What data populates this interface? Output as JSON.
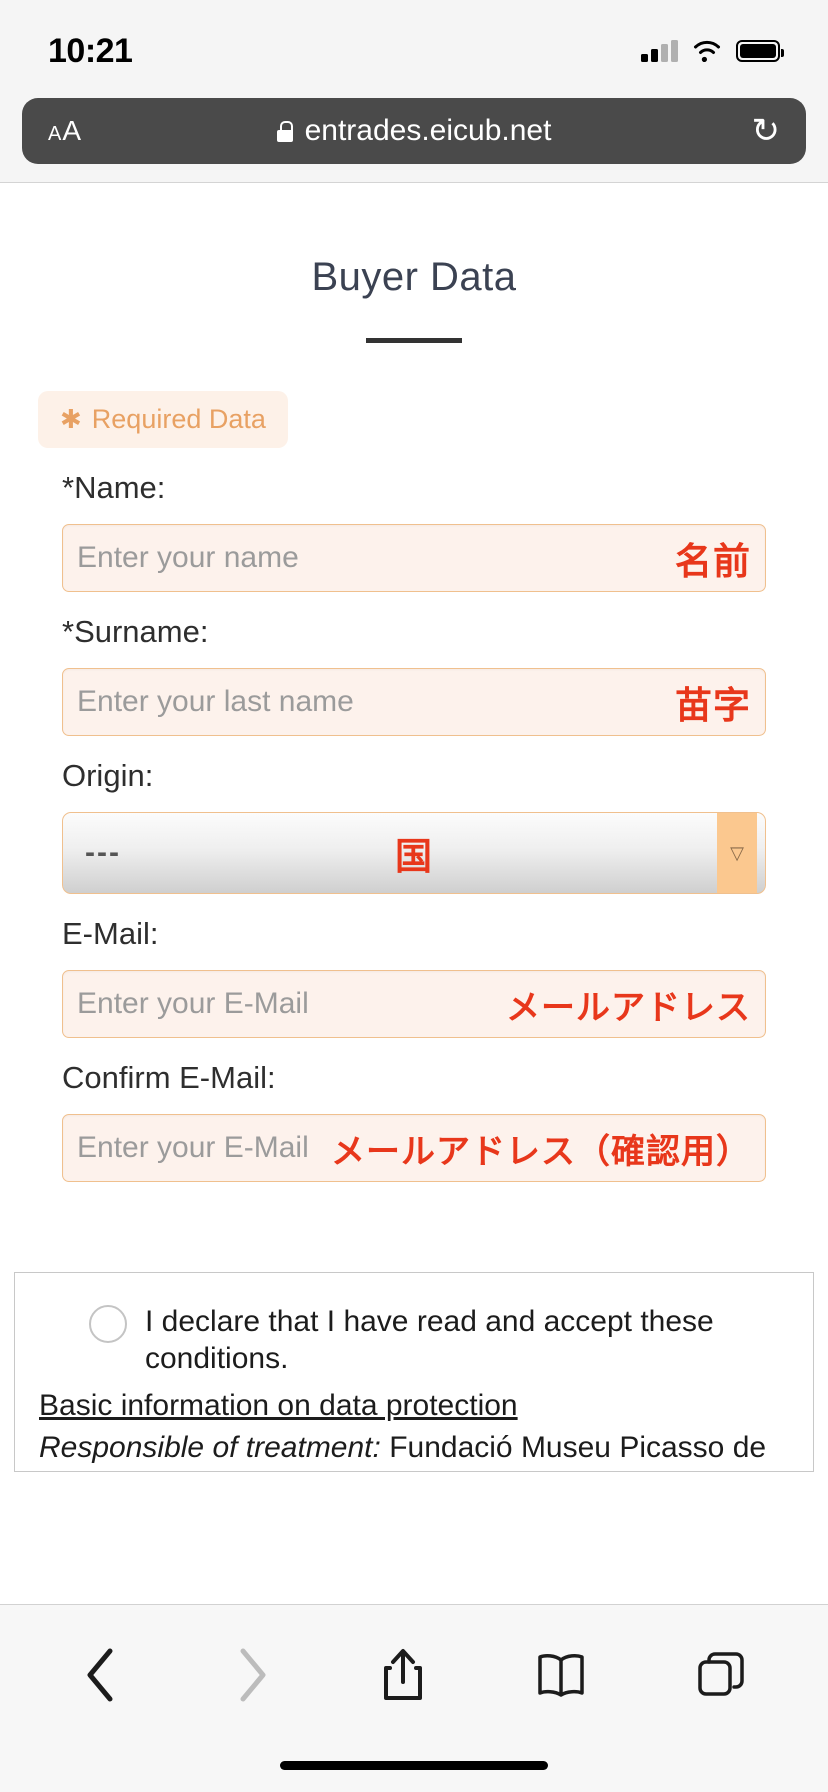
{
  "status_bar": {
    "time": "10:21",
    "icons": [
      "cellular-signal-icon",
      "wifi-icon",
      "battery-icon"
    ]
  },
  "browser": {
    "reader_label_small": "A",
    "reader_label_big": "A",
    "lock_icon": "lock-icon",
    "url": "entrades.eicub.net",
    "reload_icon": "↻"
  },
  "page": {
    "title": "Buyer Data",
    "required_badge": {
      "star": "✱",
      "label": "Required Data"
    },
    "fields": [
      {
        "label": "*Name:",
        "placeholder": "Enter your name",
        "jp": "名前",
        "type": "text"
      },
      {
        "label": "*Surname:",
        "placeholder": "Enter your last name",
        "jp": "苗字",
        "type": "text"
      },
      {
        "label": "Origin:",
        "value": "---",
        "jp": "国",
        "type": "select",
        "arrow": "▽"
      },
      {
        "label": "E-Mail:",
        "placeholder": "Enter your E-Mail",
        "jp": "メールアドレス",
        "type": "text"
      },
      {
        "label": "Confirm E-Mail:",
        "placeholder": "Enter your E-Mail",
        "jp": "メールアドレス（確認用）",
        "type": "text"
      }
    ],
    "conditions": {
      "declaration": "I declare that I have read and accept these conditions.",
      "protection_link": "Basic information on data protection",
      "responsible_label": "Responsible of treatment:",
      "responsible_value": " Fundació Museu Picasso de Barcelona."
    }
  },
  "toolbar": {
    "back": "‹",
    "forward": "›",
    "share": "share-icon",
    "bookmarks": "book-icon",
    "tabs": "tabs-icon"
  },
  "colors": {
    "accent_orange": "#e8a163",
    "field_bg": "#fdf2ec",
    "field_border": "#f0c08e",
    "jp_red": "#e8371b",
    "urlbar_bg": "#4a4a4a"
  }
}
